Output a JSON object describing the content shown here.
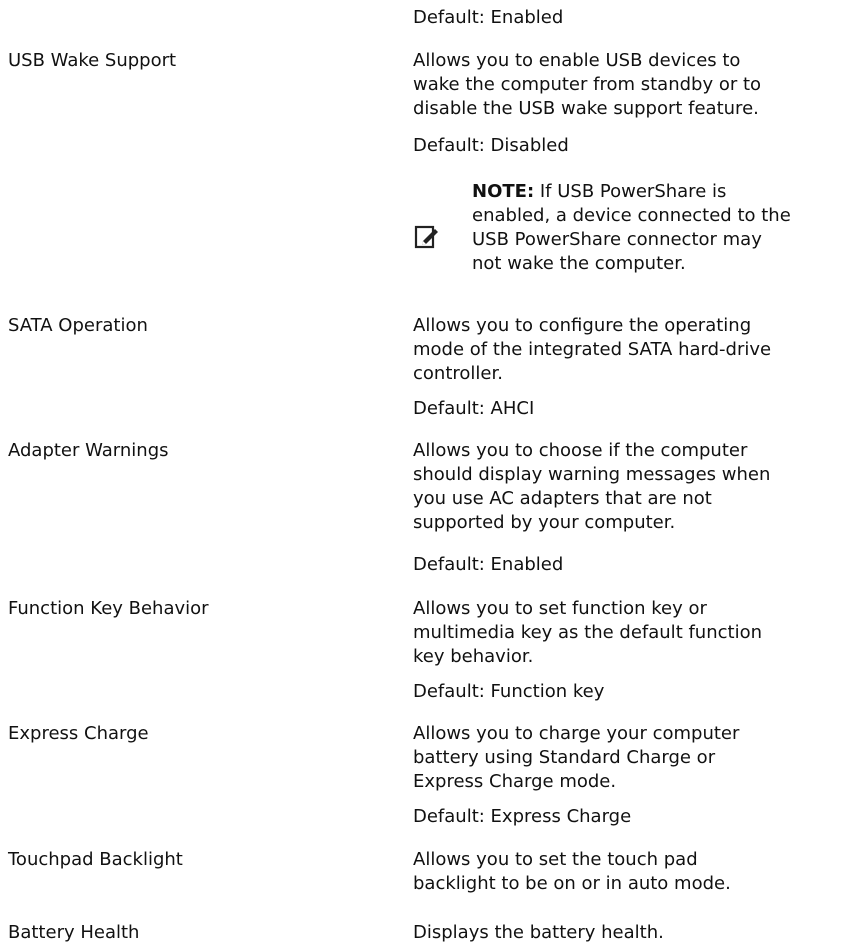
{
  "document": {
    "rows": [
      {
        "option": "",
        "description": [],
        "default": "Default: Enabled"
      },
      {
        "option": "USB Wake Support",
        "description": [
          "Allows you to enable USB devices to",
          "wake the computer from standby or to",
          "disable the USB wake support feature."
        ],
        "default": "Default: Disabled",
        "note": {
          "label": "NOTE:",
          "lines": [
            " If USB PowerShare is",
            "enabled, a device connected to the",
            "USB PowerShare connector may",
            "not wake the computer."
          ],
          "icon": "pencil-note-icon"
        }
      },
      {
        "option": "SATA Operation",
        "description": [
          "Allows you to configure the operating",
          "mode of the integrated SATA hard-drive",
          "controller."
        ],
        "default": "Default: AHCI"
      },
      {
        "option": "Adapter Warnings",
        "description": [
          "Allows you to choose if the computer",
          "should display warning messages when",
          "you use AC adapters that are not",
          "supported by your computer."
        ],
        "default": "Default: Enabled"
      },
      {
        "option": "Function Key Behavior",
        "description": [
          "Allows you to set function key or",
          "multimedia key as the default function",
          "key behavior."
        ],
        "default": "Default: Function key"
      },
      {
        "option": "Express Charge",
        "description": [
          "Allows you to charge your computer",
          "battery using Standard Charge or",
          "Express Charge mode."
        ],
        "default": "Default: Express Charge"
      },
      {
        "option": "Touchpad Backlight",
        "description": [
          "Allows you to set the touch pad",
          "backlight to be on or in auto mode."
        ]
      },
      {
        "option": "Battery Health",
        "description": [
          "Displays the battery health."
        ]
      }
    ]
  }
}
